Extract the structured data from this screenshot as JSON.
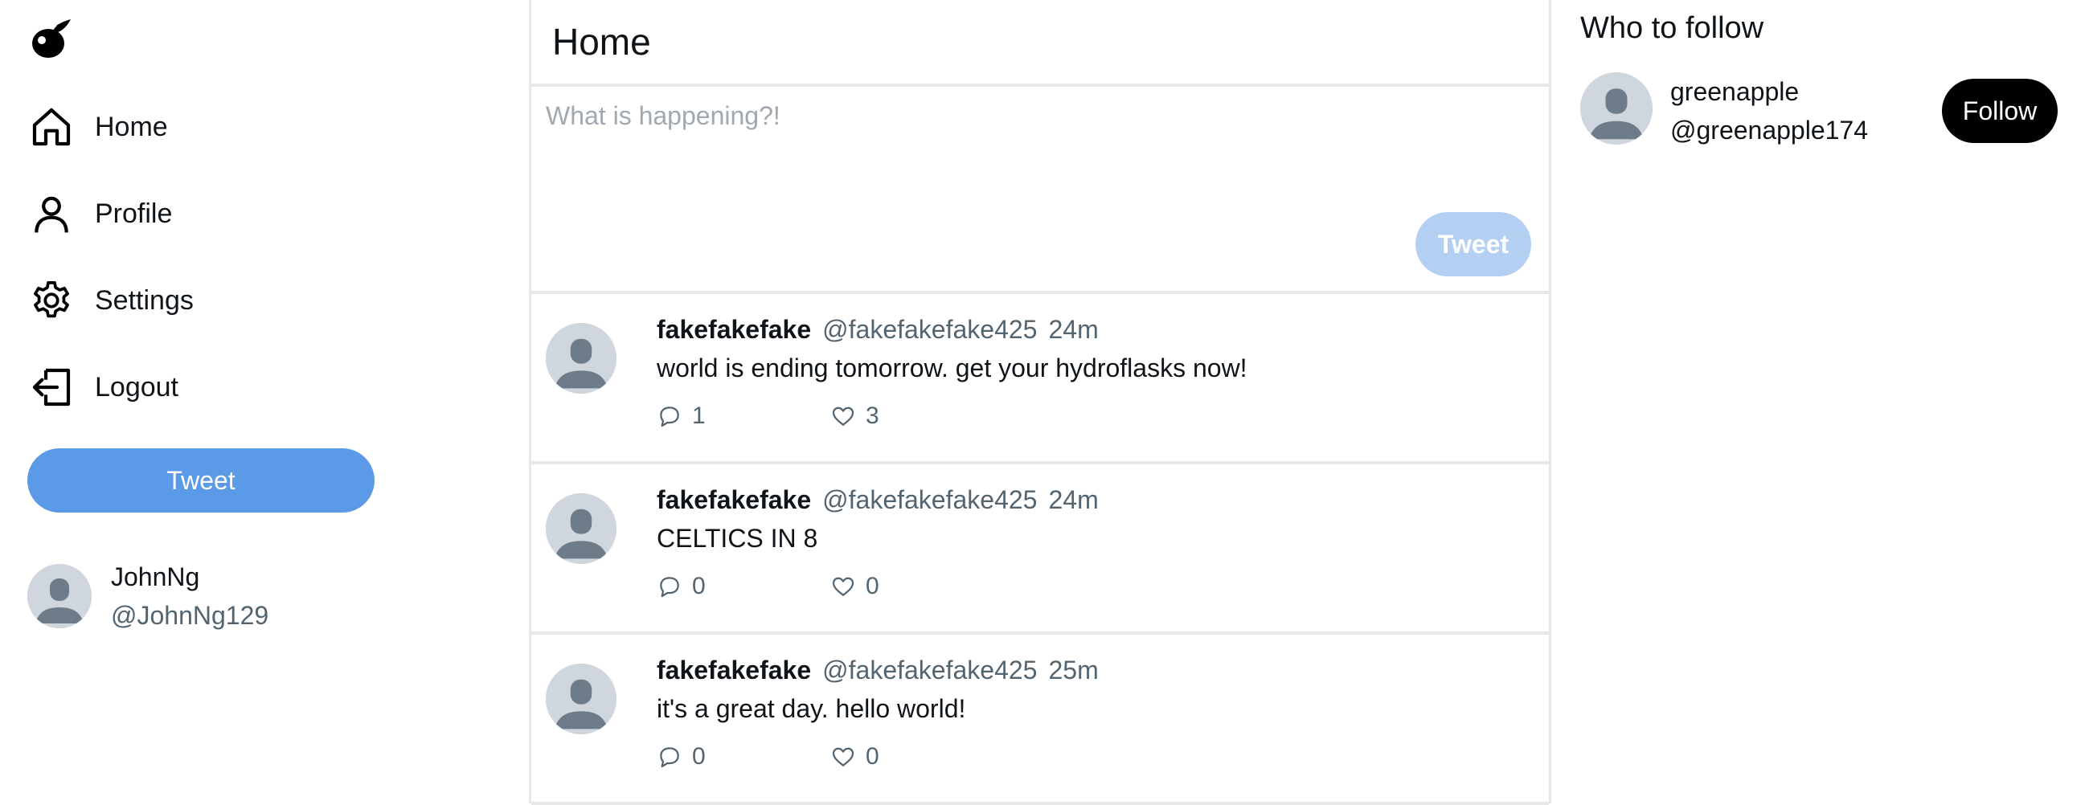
{
  "sidebar": {
    "logo_icon": "bird-logo-icon",
    "nav": [
      {
        "label": "Home",
        "icon": "home-icon"
      },
      {
        "label": "Profile",
        "icon": "person-icon"
      },
      {
        "label": "Settings",
        "icon": "gear-icon"
      },
      {
        "label": "Logout",
        "icon": "logout-icon"
      }
    ],
    "tweet_button": "Tweet",
    "current_user": {
      "name": "JohnNg",
      "handle": "@JohnNg129"
    }
  },
  "main": {
    "title": "Home",
    "composer": {
      "placeholder": "What is happening?!",
      "value": "",
      "tweet_button": "Tweet"
    },
    "tweets": [
      {
        "author": "fakefakefake",
        "handle": "@fakefakefake425",
        "time": "24m",
        "text": "world is ending tomorrow. get your hydroflasks now!",
        "replies": "1",
        "likes": "3"
      },
      {
        "author": "fakefakefake",
        "handle": "@fakefakefake425",
        "time": "24m",
        "text": "CELTICS IN 8",
        "replies": "0",
        "likes": "0"
      },
      {
        "author": "fakefakefake",
        "handle": "@fakefakefake425",
        "time": "25m",
        "text": "it's a great day. hello world!",
        "replies": "0",
        "likes": "0"
      }
    ]
  },
  "right": {
    "title": "Who to follow",
    "suggestions": [
      {
        "name": "greenapple",
        "handle": "@greenapple174",
        "button": "Follow"
      }
    ]
  },
  "colors": {
    "accent": "#5b9ae6",
    "accent_disabled": "#b3cff2",
    "border": "#e6e8ea",
    "muted_text": "#536471",
    "avatar_bg": "#cfd6dd",
    "avatar_fg": "#6e7c89"
  }
}
